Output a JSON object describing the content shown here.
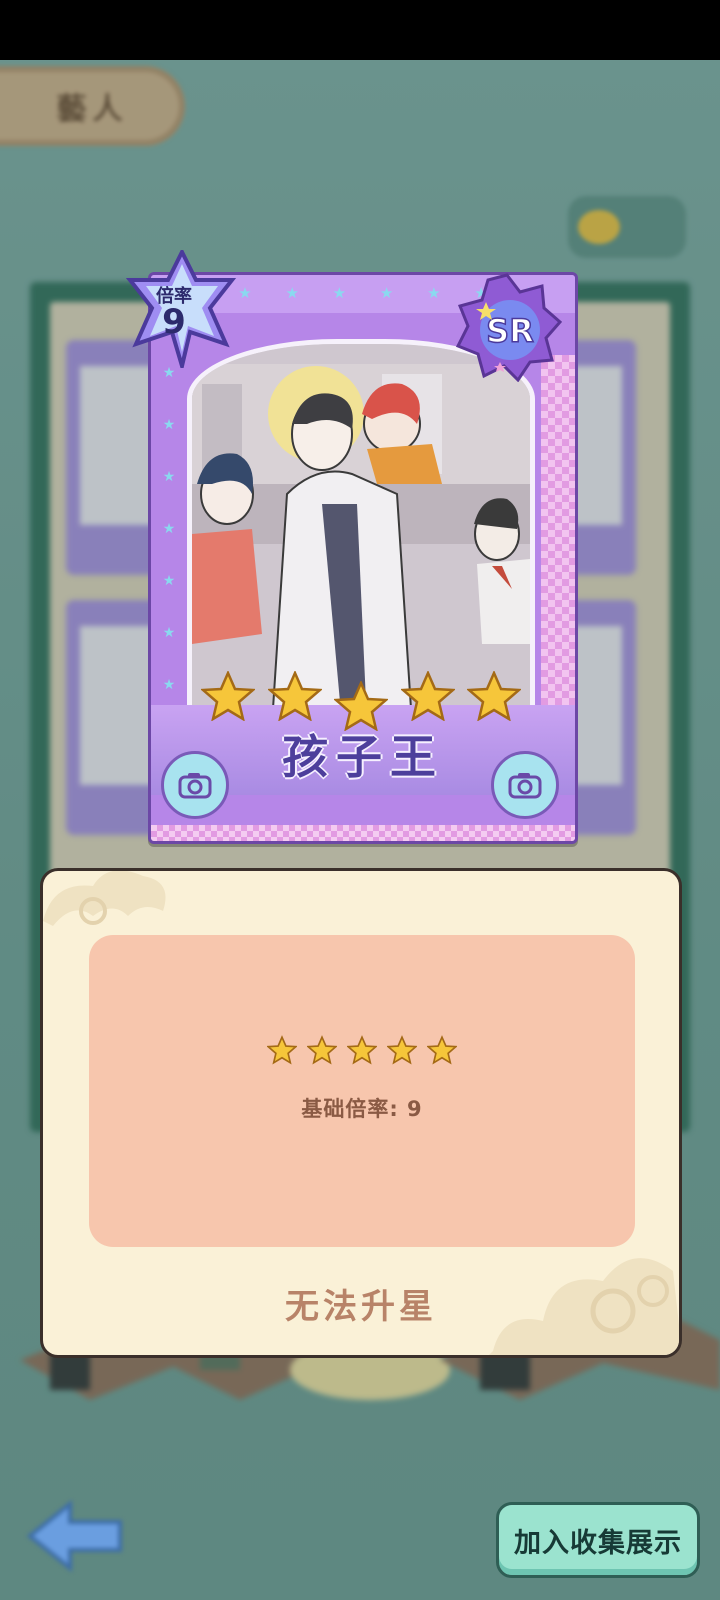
{
  "background": {
    "tab_label": "藝人"
  },
  "card": {
    "multiplier_label": "倍率",
    "multiplier_value": "9",
    "rarity": "SR",
    "name": "孩子王",
    "star_count": 5
  },
  "info_panel": {
    "star_count": 5,
    "base_rate_text": "基础倍率: 9",
    "upgrade_status": "无法升星"
  },
  "actions": {
    "collect_button_label": "加入收集展示"
  },
  "colors": {
    "card_purple": "#b686e8",
    "panel_bg": "#faf1d7",
    "info_box": "#f7c6ad",
    "star_gold": "#f6c63a",
    "button_mint": "#9be3cf"
  }
}
